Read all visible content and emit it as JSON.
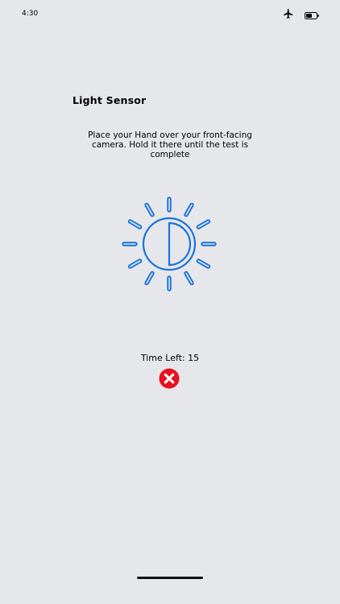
{
  "status_bar": {
    "time": "4:30",
    "icons": [
      "airplane-mode-icon",
      "battery-icon"
    ]
  },
  "screen": {
    "title": "Light Sensor",
    "instruction": "Place your Hand over your front-facing camera. Hold it there until the test is complete",
    "timer_label": "Time Left: 15",
    "timer_seconds": 15,
    "graphic": "brightness-sun-icon",
    "cancel_icon": "cancel-x-icon"
  },
  "colors": {
    "background": "#e6e7ea",
    "accent_blue": "#1a73d9",
    "cancel_red": "#e8101f"
  }
}
